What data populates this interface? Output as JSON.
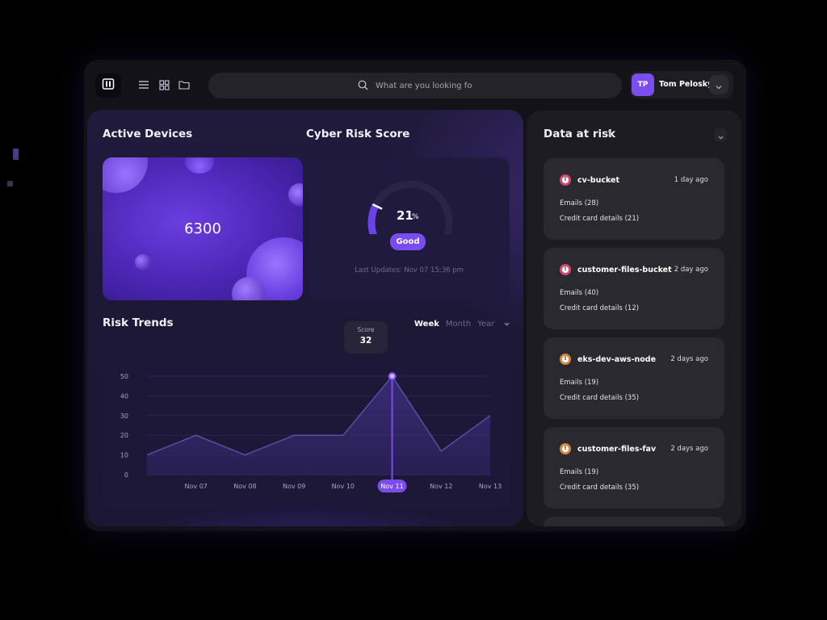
{
  "search": {
    "placeholder": "What are you looking for?"
  },
  "user": {
    "initials": "TP",
    "name": "Tom Pelosky"
  },
  "active_devices": {
    "title": "Active Devices",
    "value": "6300"
  },
  "cyber_risk": {
    "title": "Cyber Risk Score",
    "score": "21",
    "score_fraction": 0.21,
    "unit": "%",
    "status": "Good",
    "last_update": "Last Updates: Nov 07 15:36 pm"
  },
  "risk_trends": {
    "title": "Risk Trends",
    "ranges": [
      "Week",
      "Month",
      "Year"
    ],
    "active_range": "Week",
    "tooltip": {
      "label": "Score",
      "value": "32"
    }
  },
  "chart_data": {
    "type": "area",
    "categories": [
      "",
      "Nov 07",
      "Nov 08",
      "Nov 09",
      "Nov 10",
      "Nov 11",
      "Nov 12",
      "Nov 13"
    ],
    "highlight_category": "Nov 11",
    "values": [
      10,
      20,
      10,
      20,
      20,
      50,
      12,
      30
    ],
    "ylim": [
      0,
      50
    ],
    "yticks": [
      0,
      10,
      20,
      30,
      40,
      50
    ],
    "grid": true,
    "colors": {
      "line": "#5b4fa0",
      "fill": "#3b2f80",
      "highlight": "#7a4cf0"
    }
  },
  "data_at_risk": {
    "title": "Data at risk",
    "count": "5",
    "items": [
      {
        "name": "cv-bucket",
        "time": "1 day ago",
        "line1": "Emails (28)",
        "line2": "Credit card details (21)",
        "color": "#d24a6e"
      },
      {
        "name": "customer-files-bucket",
        "time": "2 day ago",
        "line1": "Emails (40)",
        "line2": "Credit card details (12)",
        "color": "#d24a6e"
      },
      {
        "name": "eks-dev-aws-node",
        "time": "2 days ago",
        "line1": "Emails (19)",
        "line2": "Credit card details (35)",
        "color": "#d9883c"
      },
      {
        "name": "customer-files-fav",
        "time": "2 days ago",
        "line1": "Emails (19)",
        "line2": "Credit card details (35)",
        "color": "#d9883c"
      }
    ]
  }
}
